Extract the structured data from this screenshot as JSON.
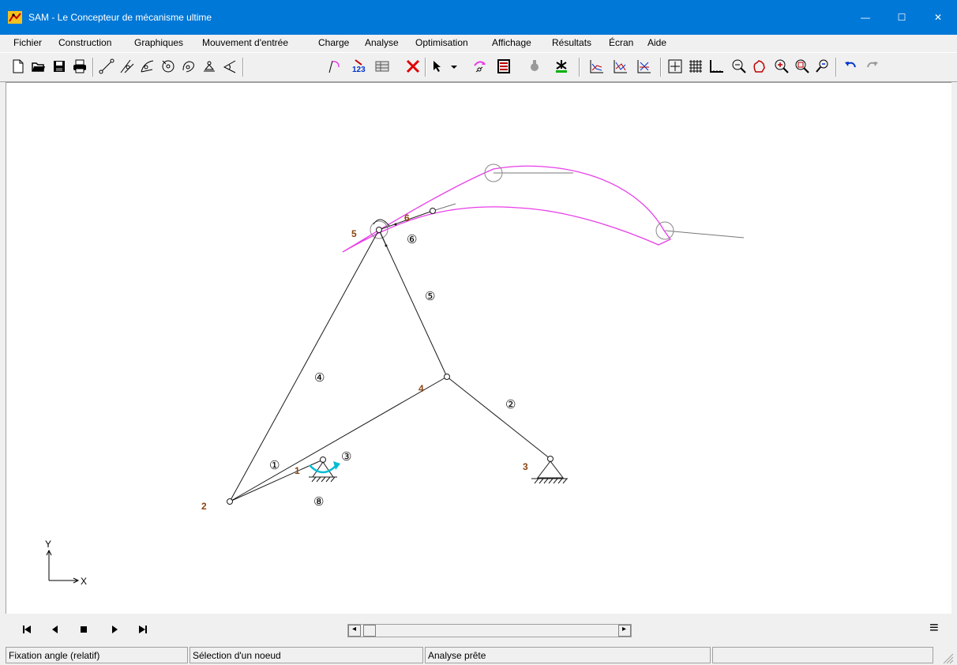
{
  "window": {
    "title": "SAM - Le Concepteur de mécanisme ultime",
    "controls": {
      "minimize": "—",
      "maximize": "☐",
      "close": "✕"
    }
  },
  "menu": {
    "items": [
      "Fichier",
      "Construction",
      "Graphiques",
      "Mouvement d'entrée",
      "Charge",
      "Analyse",
      "Optimisation",
      "Affichage",
      "Résultats",
      "Écran",
      "Aide"
    ]
  },
  "toolbar": {
    "buttons": [
      "new-file-icon",
      "open-folder-icon",
      "save-icon",
      "print-icon",
      "beam-icon",
      "slider-icon",
      "gear-pair-icon",
      "pulley-icon",
      "cam-icon",
      "fixed-support-icon",
      "angle-constraint-icon",
      "motion-path-icon",
      "numbering-icon",
      "table-icon",
      "delete-icon",
      "select-arrow-icon",
      "dropdown-icon",
      "input-motion-icon",
      "spring-icon",
      "damper-icon",
      "load-icon",
      "graph-1-icon",
      "graph-2-icon",
      "graph-3-icon",
      "fit-icon",
      "grid-icon",
      "axis-icon",
      "zoom-out-icon",
      "pan-icon",
      "zoom-in-icon",
      "zoom-window-icon",
      "zoom-previous-icon",
      "undo-icon",
      "redo-icon"
    ]
  },
  "canvas": {
    "node_labels": [
      "1",
      "2",
      "3",
      "4",
      "5",
      "6"
    ],
    "element_labels": [
      "①",
      "②",
      "③",
      "④",
      "⑤",
      "⑥",
      "⑧"
    ],
    "axis_labels": {
      "x": "X",
      "y": "Y"
    }
  },
  "colors": {
    "titlebar": "#0078d7",
    "curve": "#e83ee8",
    "input_arrow": "#00bcd4",
    "node_label": "#8b4513",
    "mechanism": "#1a1a1a"
  },
  "playback": {
    "buttons": [
      "first-frame-icon",
      "step-back-icon",
      "stop-icon",
      "play-icon",
      "last-frame-icon"
    ],
    "menu_icon": "≡",
    "scroll_left": "◂",
    "scroll_right": "▸"
  },
  "statusbar": {
    "panels": [
      "Fixation angle (relatif)",
      "Sélection d'un noeud",
      "Analyse prête",
      ""
    ]
  }
}
